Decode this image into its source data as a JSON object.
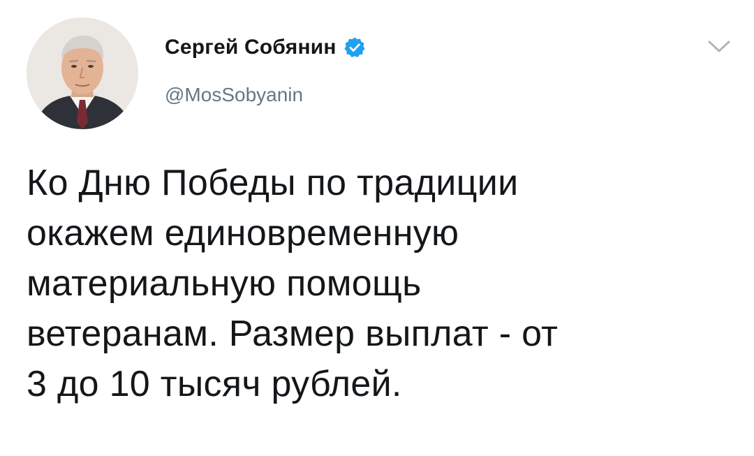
{
  "author": {
    "display_name": "Сергей Собянин",
    "handle": "@MosSobyanin",
    "verified": true,
    "avatar_icon": "profile-photo"
  },
  "menu": {
    "icon": "chevron-down-icon"
  },
  "tweet": {
    "lines": [
      "Ко Дню Победы по традиции",
      "окажем единовременную",
      "материальную помощь",
      "ветеранам. Размер выплат - от",
      "3 до 10 тысяч рублей."
    ]
  },
  "colors": {
    "verified_badge": "#1da1f2",
    "text_primary": "#14171a",
    "text_secondary": "#657786",
    "chevron": "#aab8c2"
  }
}
